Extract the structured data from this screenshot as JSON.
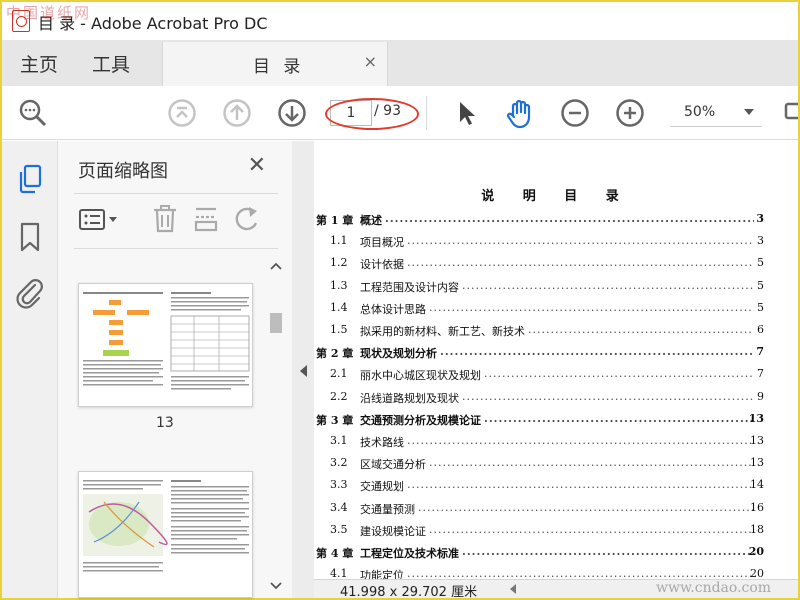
{
  "window": {
    "title": "目 录 - Adobe Acrobat Pro DC",
    "watermark_top": "中国道纸网"
  },
  "tabs": {
    "home": "主页",
    "tools": "工具",
    "document": "目 录",
    "close": "×"
  },
  "toolbar": {
    "page_current": "1",
    "page_total": "/ 93",
    "zoom": "50%"
  },
  "pane": {
    "title": "页面缩略图",
    "close": "✕",
    "thumbnails": [
      {
        "page": "13"
      },
      {
        "page": ""
      }
    ]
  },
  "document": {
    "heading": "说 明 目 录",
    "toc": [
      {
        "num": "第 1 章",
        "text": "概述",
        "page": "3",
        "chapter": true
      },
      {
        "num": "1.1",
        "text": "项目概况",
        "page": "3"
      },
      {
        "num": "1.2",
        "text": "设计依据",
        "page": "5"
      },
      {
        "num": "1.3",
        "text": "工程范围及设计内容",
        "page": "5"
      },
      {
        "num": "1.4",
        "text": "总体设计思路",
        "page": "5"
      },
      {
        "num": "1.5",
        "text": "拟采用的新材料、新工艺、新技术",
        "page": "6"
      },
      {
        "num": "第 2 章",
        "text": "现状及规划分析",
        "page": "7",
        "chapter": true
      },
      {
        "num": "2.1",
        "text": "丽水中心城区现状及规划",
        "page": "7"
      },
      {
        "num": "2.2",
        "text": "沿线道路规划及现状",
        "page": "9"
      },
      {
        "num": "第 3 章",
        "text": "交通预测分析及规模论证",
        "page": "13",
        "chapter": true
      },
      {
        "num": "3.1",
        "text": "技术路线",
        "page": "13"
      },
      {
        "num": "3.2",
        "text": "区域交通分析",
        "page": "13"
      },
      {
        "num": "3.3",
        "text": "交通规划",
        "page": "14"
      },
      {
        "num": "3.4",
        "text": "交通量预测",
        "page": "16"
      },
      {
        "num": "3.5",
        "text": "建设规模论证",
        "page": "18"
      },
      {
        "num": "第 4 章",
        "text": "工程定位及技术标准",
        "page": "20",
        "chapter": true
      },
      {
        "num": "4.1",
        "text": "功能定位",
        "page": "20"
      }
    ]
  },
  "status": {
    "dimensions": "41.998 x 29.702 厘米",
    "watermark": "www.cndao.com"
  }
}
